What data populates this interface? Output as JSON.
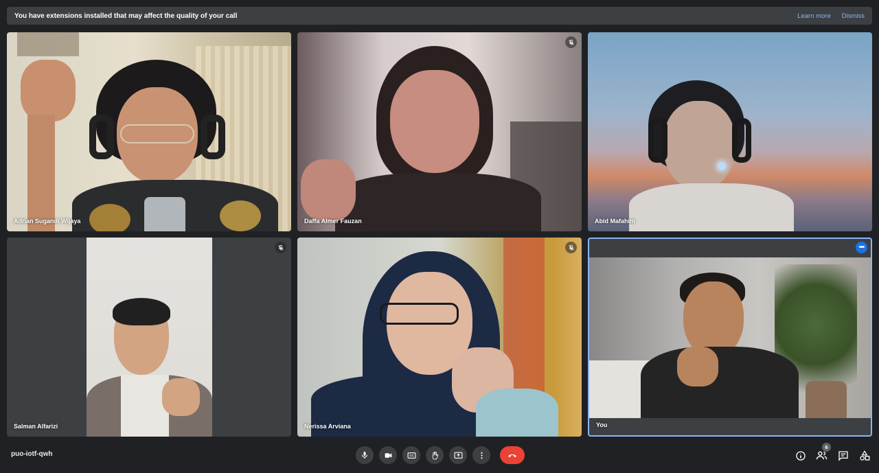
{
  "banner": {
    "message": "You have extensions installed that may affect the quality of your call",
    "learn_more": "Learn more",
    "dismiss": "Dismiss"
  },
  "participants": [
    {
      "name": "Adrian Sugandi Wijaya",
      "muted": false
    },
    {
      "name": "Daffa Almer Fauzan",
      "muted": true
    },
    {
      "name": "Abid Mafahim",
      "muted": false
    },
    {
      "name": "Salman Alfarizi",
      "muted": true
    },
    {
      "name": "Nerissa Arviana",
      "muted": true
    },
    {
      "name": "You",
      "muted": false,
      "active": true
    }
  ],
  "bottom_bar": {
    "meeting_code": "puo-iotf-qwh",
    "participant_count": "6",
    "controls": [
      "mic-icon",
      "camera-icon",
      "captions-icon",
      "raise-hand-icon",
      "present-icon",
      "more-options-icon",
      "end-call-icon"
    ],
    "right_icons": [
      "info-icon",
      "people-icon",
      "chat-icon",
      "activities-icon"
    ]
  },
  "colors": {
    "background": "#202124",
    "tile": "#3c4043",
    "accent": "#8ab4f8",
    "end_call": "#ea4335",
    "active_button": "#1a73e8"
  }
}
